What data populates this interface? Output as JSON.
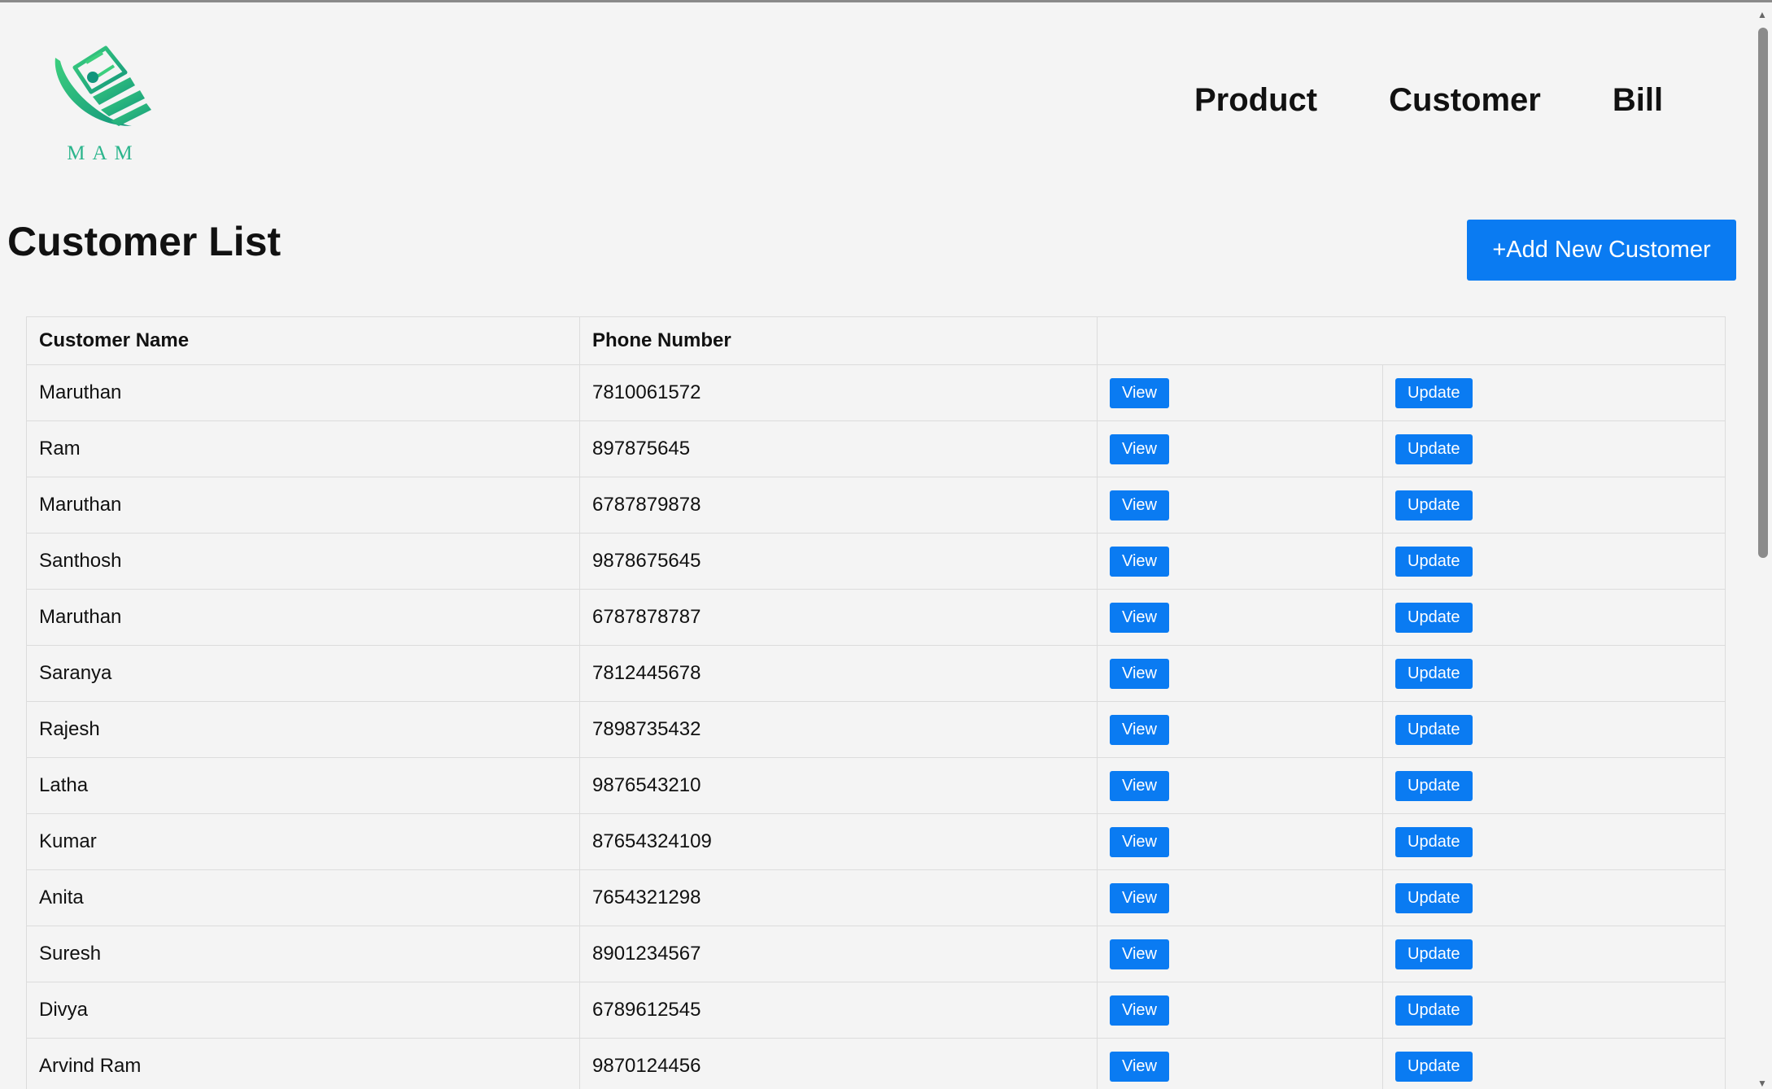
{
  "brand": {
    "logo_icon": "money-wings-logo",
    "logo_text": "MAM"
  },
  "nav": {
    "items": [
      "Product",
      "Customer",
      "Bill"
    ]
  },
  "page": {
    "title": "Customer List",
    "add_button_label": "+Add New Customer"
  },
  "table": {
    "columns": [
      "Customer Name",
      "Phone Number",
      ""
    ],
    "view_label": "View",
    "update_label": "Update",
    "rows": [
      {
        "name": "Maruthan",
        "phone": "7810061572"
      },
      {
        "name": "Ram",
        "phone": "897875645"
      },
      {
        "name": "Maruthan",
        "phone": "6787879878"
      },
      {
        "name": "Santhosh",
        "phone": "9878675645"
      },
      {
        "name": "Maruthan",
        "phone": "6787878787"
      },
      {
        "name": "Saranya",
        "phone": "7812445678"
      },
      {
        "name": "Rajesh",
        "phone": "7898735432"
      },
      {
        "name": "Latha",
        "phone": "9876543210"
      },
      {
        "name": "Kumar",
        "phone": "87654324109"
      },
      {
        "name": "Anita",
        "phone": "7654321298"
      },
      {
        "name": "Suresh",
        "phone": "8901234567"
      },
      {
        "name": "Divya",
        "phone": "6789612545"
      },
      {
        "name": "Arvind Ram",
        "phone": "9870124456"
      }
    ]
  },
  "colors": {
    "accent": "#0a7bf2",
    "logo_green": "#2bb58c",
    "background": "#f4f4f4"
  }
}
